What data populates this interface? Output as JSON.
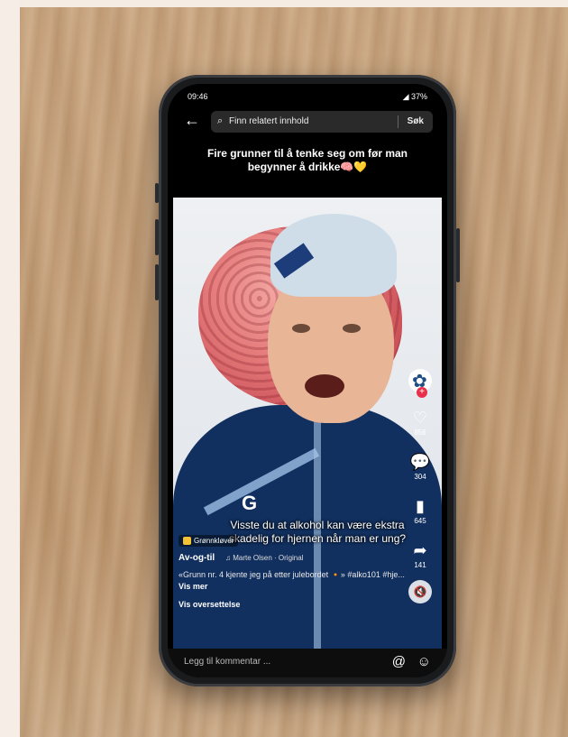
{
  "status": {
    "time": "09:46",
    "battery": "37%"
  },
  "search": {
    "placeholder": "Finn relatert innhold",
    "button": "Søk"
  },
  "header": {
    "title": "Fire grunner til å tenke seg om før man begynner å drikke🧠💛"
  },
  "video": {
    "caption": "Visste du at alkohol kan være ekstra skadelig for hjernen når man er ung?"
  },
  "rail": {
    "likes": "856",
    "comments": "304",
    "saves": "645",
    "shares": "141"
  },
  "post": {
    "tag": "Grønnkløver",
    "username": "Av-og-til",
    "music": "♫ Marte Olsen · Original",
    "description": "«Grunn nr. 4 kjente jeg på etter julebordet 🔸» #alko101 #hje...",
    "more": "Vis mer",
    "translate": "Vis oversettelse"
  },
  "comment": {
    "placeholder": "Legg til kommentar ..."
  },
  "icons": [
    "back-arrow-icon",
    "search-icon",
    "heart-icon",
    "comment-icon",
    "bookmark-icon",
    "share-icon",
    "mute-icon",
    "at-icon",
    "emoji-icon"
  ]
}
